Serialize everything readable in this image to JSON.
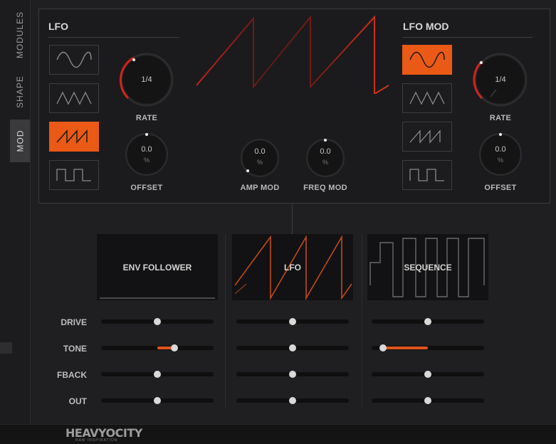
{
  "sidebar": {
    "tabs": [
      {
        "label": "MODULES",
        "active": false
      },
      {
        "label": "SHAPE",
        "active": false
      },
      {
        "label": "MOD",
        "active": true
      }
    ]
  },
  "lfo": {
    "title": "LFO",
    "shapes": [
      "sine-wave-icon",
      "triangle-wave-icon",
      "sawtooth-wave-icon",
      "square-wave-icon"
    ],
    "selected_shape": "sawtooth-wave-icon",
    "rate": {
      "value": "1/4",
      "label": "RATE"
    },
    "offset": {
      "value": "0.0",
      "unit": "%",
      "label": "OFFSET"
    }
  },
  "lfo_mod": {
    "title": "LFO MOD",
    "shapes": [
      "sine-wave-icon",
      "triangle-wave-icon",
      "sawtooth-wave-icon",
      "square-wave-icon"
    ],
    "selected_shape": "sine-wave-icon",
    "rate": {
      "value": "1/4",
      "label": "RATE"
    },
    "offset": {
      "value": "0.0",
      "unit": "%",
      "label": "OFFSET"
    }
  },
  "center": {
    "amp_mod": {
      "value": "0.0",
      "unit": "%",
      "label": "AMP MOD"
    },
    "freq_mod": {
      "value": "0.0",
      "unit": "%",
      "label": "FREQ MOD"
    }
  },
  "modulators": {
    "cards": [
      {
        "label": "ENV FOLLOWER",
        "active": false
      },
      {
        "label": "LFO",
        "active": true
      },
      {
        "label": "SEQUENCE",
        "active": false
      }
    ],
    "rows": [
      {
        "label": "DRIVE",
        "values": [
          0.5,
          0.5,
          0.5
        ]
      },
      {
        "label": "TONE",
        "values": [
          0.65,
          0.5,
          0.1
        ],
        "fill_from": [
          0.5,
          null,
          0.1
        ],
        "fill_to": [
          0.65,
          null,
          0.5
        ]
      },
      {
        "label": "FBACK",
        "values": [
          0.5,
          0.5,
          0.5
        ]
      },
      {
        "label": "OUT",
        "values": [
          0.5,
          0.5,
          0.5
        ]
      }
    ]
  },
  "footer": {
    "brand": "HEAVYOCITY",
    "tagline": "RAW INSPIRATION"
  },
  "colors": {
    "accent": "#ea5a16",
    "background": "#1f1f21",
    "panel": "#1b1b1d"
  }
}
